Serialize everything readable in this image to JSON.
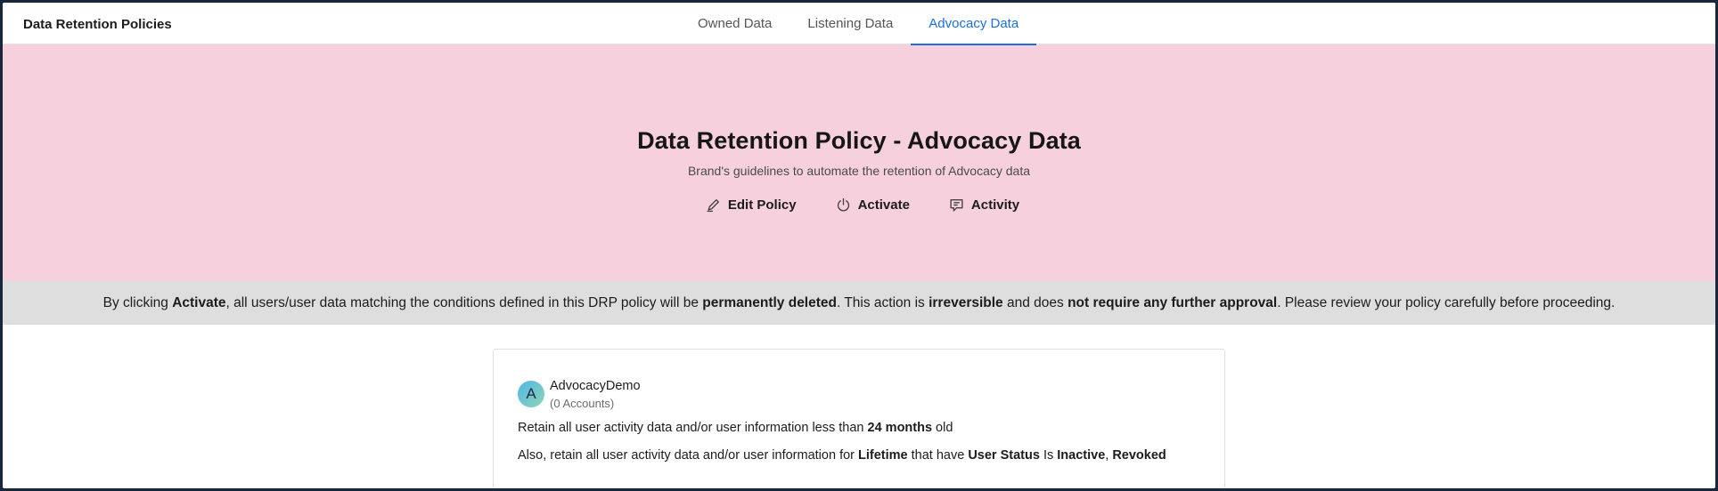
{
  "header": {
    "app_title": "Data Retention Policies",
    "tabs": [
      {
        "label": "Owned Data",
        "active": false
      },
      {
        "label": "Listening Data",
        "active": false
      },
      {
        "label": "Advocacy Data",
        "active": true
      }
    ]
  },
  "hero": {
    "title": "Data Retention Policy - Advocacy Data",
    "subtitle": "Brand's guidelines to automate the retention of Advocacy data",
    "actions": [
      {
        "label": "Edit Policy",
        "icon": "pencil-icon"
      },
      {
        "label": "Activate",
        "icon": "power-icon"
      },
      {
        "label": "Activity",
        "icon": "activity-icon"
      }
    ],
    "background_color": "#f6d1dd"
  },
  "warning": {
    "t1": "By clicking ",
    "b1": "Activate",
    "t2": ", all users/user data matching the conditions defined in this DRP policy will be ",
    "b2": "permanently deleted",
    "t3": ". This action is ",
    "b3": "irreversible",
    "t4": " and does ",
    "b4": "not require any further approval",
    "t5": ". Please review your policy carefully before proceeding."
  },
  "card": {
    "avatar_letter": "A",
    "name": "AdvocacyDemo",
    "account_count": "(0 Accounts)",
    "rule1": {
      "t1": "Retain all user activity data and/or user information less than ",
      "b1": "24 months",
      "t2": " old"
    },
    "rule2": {
      "t1": "Also, retain all user activity data and/or user information for ",
      "b1": "Lifetime",
      "t2": " that have ",
      "b2": "User Status",
      "t3": " Is ",
      "b3": "Inactive",
      "t4": ", ",
      "b4": "Revoked"
    }
  },
  "colors": {
    "accent": "#1b6fe0",
    "warning_bg": "#dedede"
  }
}
